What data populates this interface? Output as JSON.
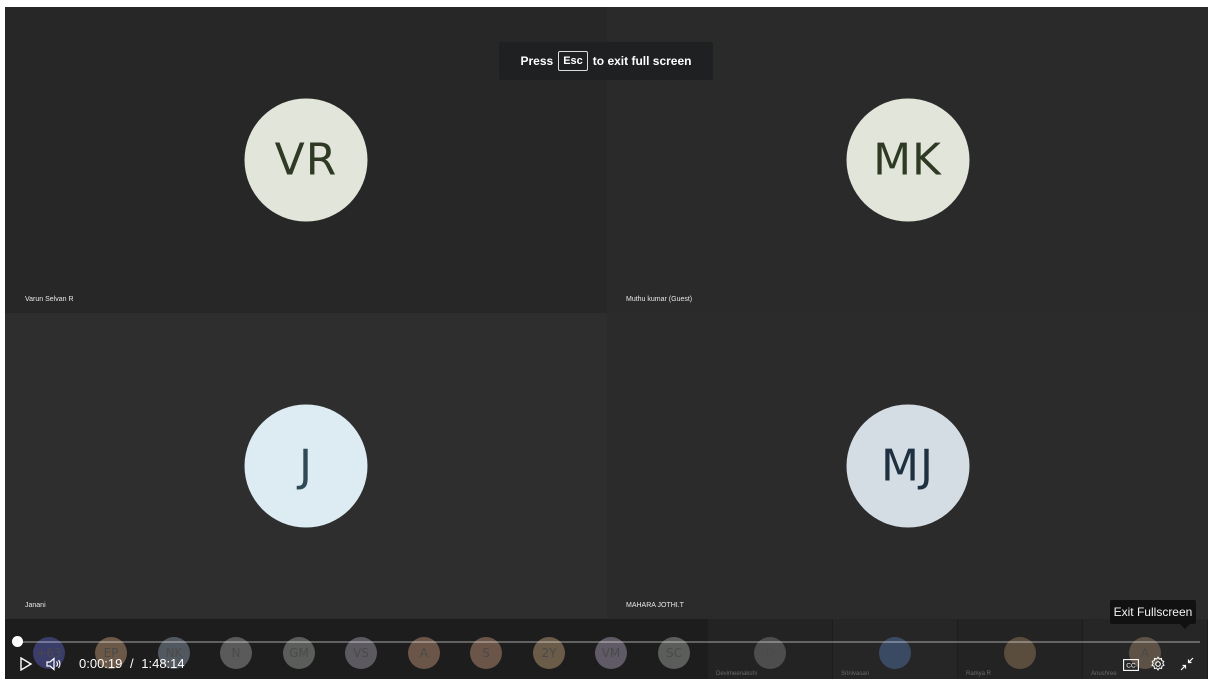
{
  "fullscreen_notice": {
    "prefix": "Press",
    "key": "Esc",
    "suffix": "to exit full screen"
  },
  "tiles": [
    {
      "initials": "VR",
      "name": "Varun Selvan R",
      "avatar_bg": "#e2e5da",
      "avatar_fg": "#2f3a24"
    },
    {
      "initials": "MK",
      "name": "Muthu kumar (Guest)",
      "avatar_bg": "#e2e5da",
      "avatar_fg": "#2f3a24"
    },
    {
      "initials": "J",
      "name": "Janani",
      "avatar_bg": "#dcecf2",
      "avatar_fg": "#2e4a55"
    },
    {
      "initials": "MJ",
      "name": "MAHARA JOTHI.T",
      "avatar_bg": "#d4dce4",
      "avatar_fg": "#1f3040"
    }
  ],
  "participant_strip": [
    {
      "initials": "+63",
      "color": "#3a3c6a"
    },
    {
      "initials": "EP",
      "color": "#6b5847"
    },
    {
      "initials": "NK",
      "color": "#52585f"
    },
    {
      "initials": "N",
      "color": "#5a5a5a"
    },
    {
      "initials": "GM",
      "color": "#5a5d5a"
    },
    {
      "initials": "VS",
      "color": "#5c5a60"
    },
    {
      "initials": "A",
      "color": "#6a5548"
    },
    {
      "initials": "S",
      "color": "#6a5548"
    },
    {
      "initials": "2Y",
      "color": "#6a5c48"
    },
    {
      "initials": "VM",
      "color": "#5f5a66"
    },
    {
      "initials": "SC",
      "color": "#5a5d5a"
    }
  ],
  "dim_tiles": [
    {
      "initials": "D",
      "label": "Devimeenakshi",
      "color": "#4d4d4d"
    },
    {
      "initials": "",
      "label": "Srinivasan",
      "color": "#3b4a63"
    },
    {
      "initials": "",
      "label": "Ramya R",
      "color": "#5a4d3e"
    },
    {
      "initials": "A",
      "label": "Anushree",
      "color": "#5e5146"
    }
  ],
  "player": {
    "current_time": "0:00:19",
    "separator": "/",
    "duration": "1:48:14",
    "progress_fraction": 0.003,
    "tooltip": "Exit Fullscreen"
  },
  "colors": {
    "accent": "#ffffff",
    "stage": "#262626"
  }
}
